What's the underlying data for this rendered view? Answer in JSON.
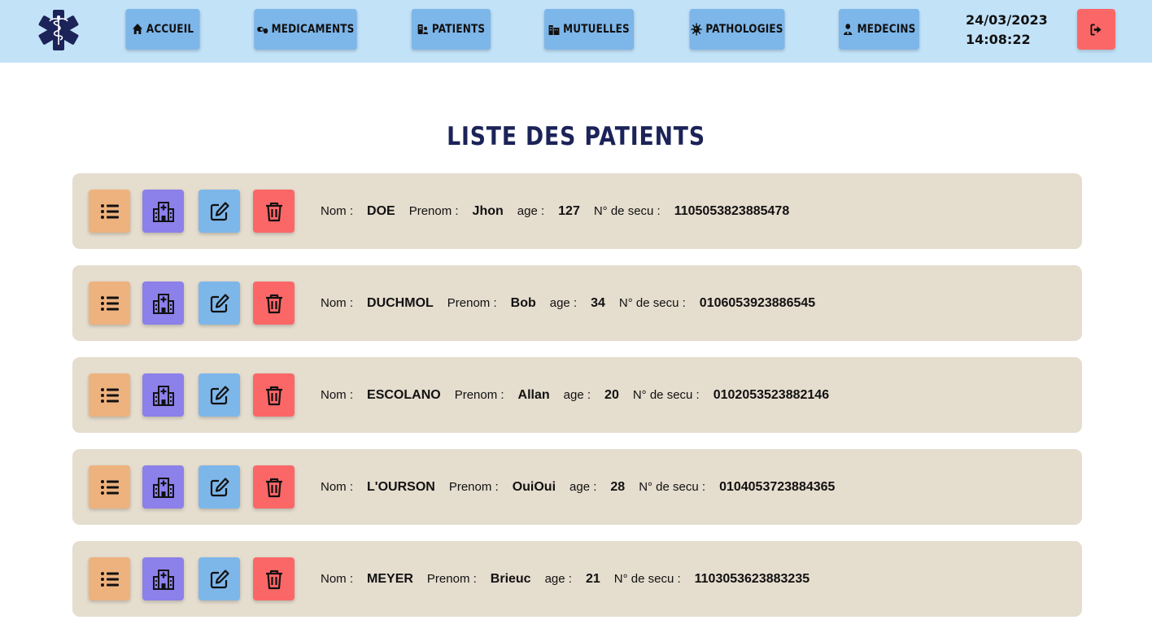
{
  "nav": {
    "items": [
      {
        "label": "ACCUEIL",
        "icon": "home-icon"
      },
      {
        "label": "MEDICAMENTS",
        "icon": "pills-icon"
      },
      {
        "label": "PATIENTS",
        "icon": "patients-icon"
      },
      {
        "label": "MUTUELLES",
        "icon": "buildings-icon"
      },
      {
        "label": "PATHOLOGIES",
        "icon": "virus-icon"
      },
      {
        "label": "MEDECINS",
        "icon": "doctor-icon"
      }
    ],
    "date": "24/03/2023",
    "time": "14:08:22",
    "logout_icon": "logout-icon"
  },
  "page": {
    "title": "LISTE DES PATIENTS"
  },
  "labels": {
    "nom": "Nom :",
    "prenom": "Prenom :",
    "age": "age :",
    "secu": "N° de secu :"
  },
  "patients": [
    {
      "nom": "DOE",
      "prenom": "Jhon",
      "age": "127",
      "secu": "1105053823885478"
    },
    {
      "nom": "DUCHMOL",
      "prenom": "Bob",
      "age": "34",
      "secu": "0106053923886545"
    },
    {
      "nom": "ESCOLANO",
      "prenom": "Allan",
      "age": "20",
      "secu": "0102053523882146"
    },
    {
      "nom": "L'OURSON",
      "prenom": "OuiOui",
      "age": "28",
      "secu": "0104053723884365"
    },
    {
      "nom": "MEYER",
      "prenom": "Brieuc",
      "age": "21",
      "secu": "1103053623883235"
    }
  ],
  "colors": {
    "topbar": "#c2e2f8",
    "nav_button": "#7db6e9",
    "logout": "#fb6767",
    "row_bg": "#e5ddce",
    "list_button": "#eeb27e",
    "hospital_button": "#8c80ea",
    "edit_button": "#7db6e9",
    "delete_button": "#fb6767",
    "title": "#1b2358"
  }
}
